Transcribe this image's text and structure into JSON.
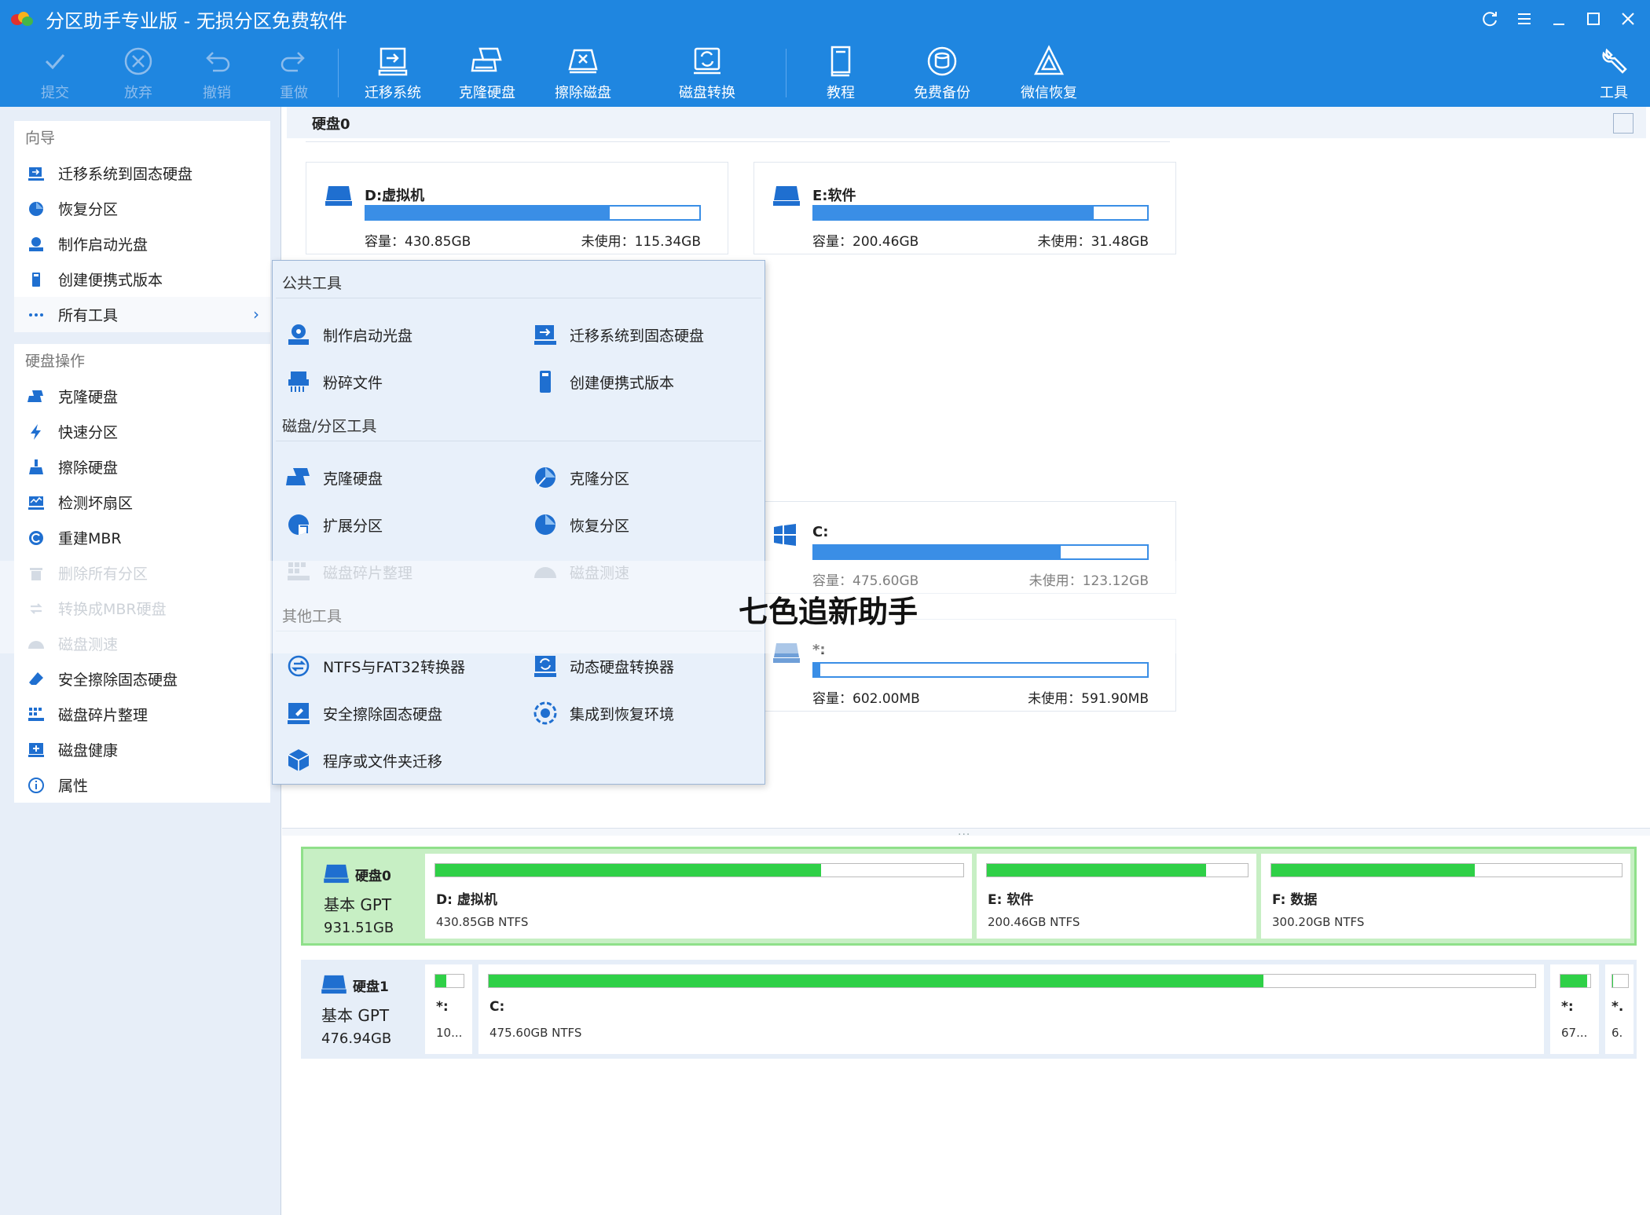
{
  "titlebar": {
    "title": "分区助手专业版 - 无损分区免费软件"
  },
  "toolbar": {
    "commit": "提交",
    "discard": "放弃",
    "undo": "撤销",
    "redo": "重做",
    "migrate": "迁移系统",
    "clone_disk": "克隆硬盘",
    "wipe_disk": "擦除磁盘",
    "disk_convert": "磁盘转换",
    "tutorial": "教程",
    "free_backup": "免费备份",
    "wechat_recovery": "微信恢复",
    "tools": "工具"
  },
  "sidebar": {
    "wizard_title": "向导",
    "wizard_items": [
      "迁移系统到固态硬盘",
      "恢复分区",
      "制作启动光盘",
      "创建便携式版本",
      "所有工具"
    ],
    "disk_ops_title": "硬盘操作",
    "disk_ops_items": [
      "克隆硬盘",
      "快速分区",
      "擦除硬盘",
      "检测坏扇区",
      "重建MBR",
      "删除所有分区",
      "转换成MBR硬盘",
      "磁盘测速",
      "安全擦除固态硬盘",
      "磁盘碎片整理",
      "磁盘健康",
      "属性"
    ]
  },
  "main": {
    "disk_header": "硬盘0",
    "cap_prefix": "容量：",
    "free_prefix": "未使用：",
    "cards": [
      {
        "name": "D:虚拟机",
        "capacity": "430.85GB",
        "free": "115.34GB",
        "used_fraction": 0.73
      },
      {
        "name": "E:软件",
        "capacity": "200.46GB",
        "free": "31.48GB",
        "used_fraction": 0.84
      },
      {
        "name": "C:",
        "capacity": "475.60GB",
        "free": "123.12GB",
        "used_fraction": 0.74
      },
      {
        "name": "*:",
        "capacity": "602.00MB",
        "free": "591.90MB",
        "used_fraction": 0.02
      }
    ]
  },
  "disk_map": {
    "disk0": {
      "name": "硬盘0",
      "type": "基本 GPT",
      "size": "931.51GB",
      "partitions": [
        {
          "name": "D: 虚拟机",
          "info": "430.85GB NTFS",
          "used_fraction": 0.73
        },
        {
          "name": "E: 软件",
          "info": "200.46GB NTFS",
          "used_fraction": 0.84
        },
        {
          "name": "F: 数据",
          "info": "300.20GB NTFS",
          "used_fraction": 0.58
        }
      ]
    },
    "disk1": {
      "name": "硬盘1",
      "type": "基本 GPT",
      "size": "476.94GB",
      "partitions": [
        {
          "name": "*:",
          "info": "10...",
          "used_fraction": 0.4
        },
        {
          "name": "C:",
          "info": "475.60GB NTFS",
          "used_fraction": 0.74
        },
        {
          "name": "*:",
          "info": "67...",
          "used_fraction": 0.9
        },
        {
          "name": "*.",
          "info": "6.",
          "used_fraction": 0.05
        }
      ]
    }
  },
  "flyout": {
    "public_title": "公共工具",
    "public_items": [
      "制作启动光盘",
      "迁移系统到固态硬盘",
      "粉碎文件",
      "创建便携式版本"
    ],
    "disk_title": "磁盘/分区工具",
    "disk_items": [
      "克隆硬盘",
      "克隆分区",
      "扩展分区",
      "恢复分区",
      "磁盘碎片整理",
      "磁盘测速"
    ],
    "other_title": "其他工具",
    "other_items": [
      "NTFS与FAT32转换器",
      "动态硬盘转换器",
      "安全擦除固态硬盘",
      "集成到恢复环境",
      "程序或文件夹迁移"
    ]
  },
  "watermark": "七色追新助手",
  "colors": {
    "accent": "#1f86e0",
    "usage_bar": "#3a8ee6",
    "partition_fill": "#2fd047",
    "selected_disk": "#c7efc4"
  }
}
